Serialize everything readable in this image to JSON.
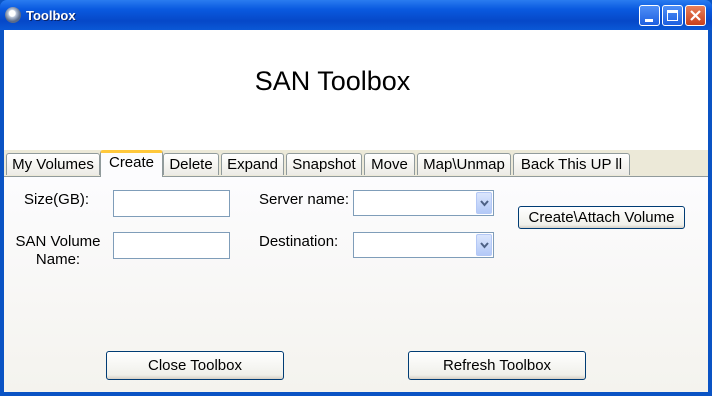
{
  "window": {
    "title": "Toolbox",
    "app_icon": "app-orb-icon"
  },
  "header": {
    "title": "SAN Toolbox"
  },
  "tabs": [
    {
      "label": "My Volumes",
      "active": false
    },
    {
      "label": "Create",
      "active": true
    },
    {
      "label": "Delete",
      "active": false
    },
    {
      "label": "Expand",
      "active": false
    },
    {
      "label": "Snapshot",
      "active": false
    },
    {
      "label": "Move",
      "active": false
    },
    {
      "label": "Map\\Unmap",
      "active": false
    },
    {
      "label": "Back This UP ll",
      "active": false
    }
  ],
  "create_form": {
    "size_label": "Size(GB):",
    "size_value": "",
    "volume_name_label_line1": "SAN Volume",
    "volume_name_label_line2": "Name:",
    "volume_name_value": "",
    "server_name_label": "Server name:",
    "server_name_value": "",
    "destination_label": "Destination:",
    "destination_value": "",
    "create_button": "Create\\Attach Volume"
  },
  "footer": {
    "close_button": "Close Toolbox",
    "refresh_button": "Refresh Toolbox"
  },
  "colors": {
    "titlebar": "#0a5ae0",
    "active_tab_highlight": "#ffc83c",
    "close_button": "#c8401c",
    "client_bg": "#ece9d8"
  }
}
